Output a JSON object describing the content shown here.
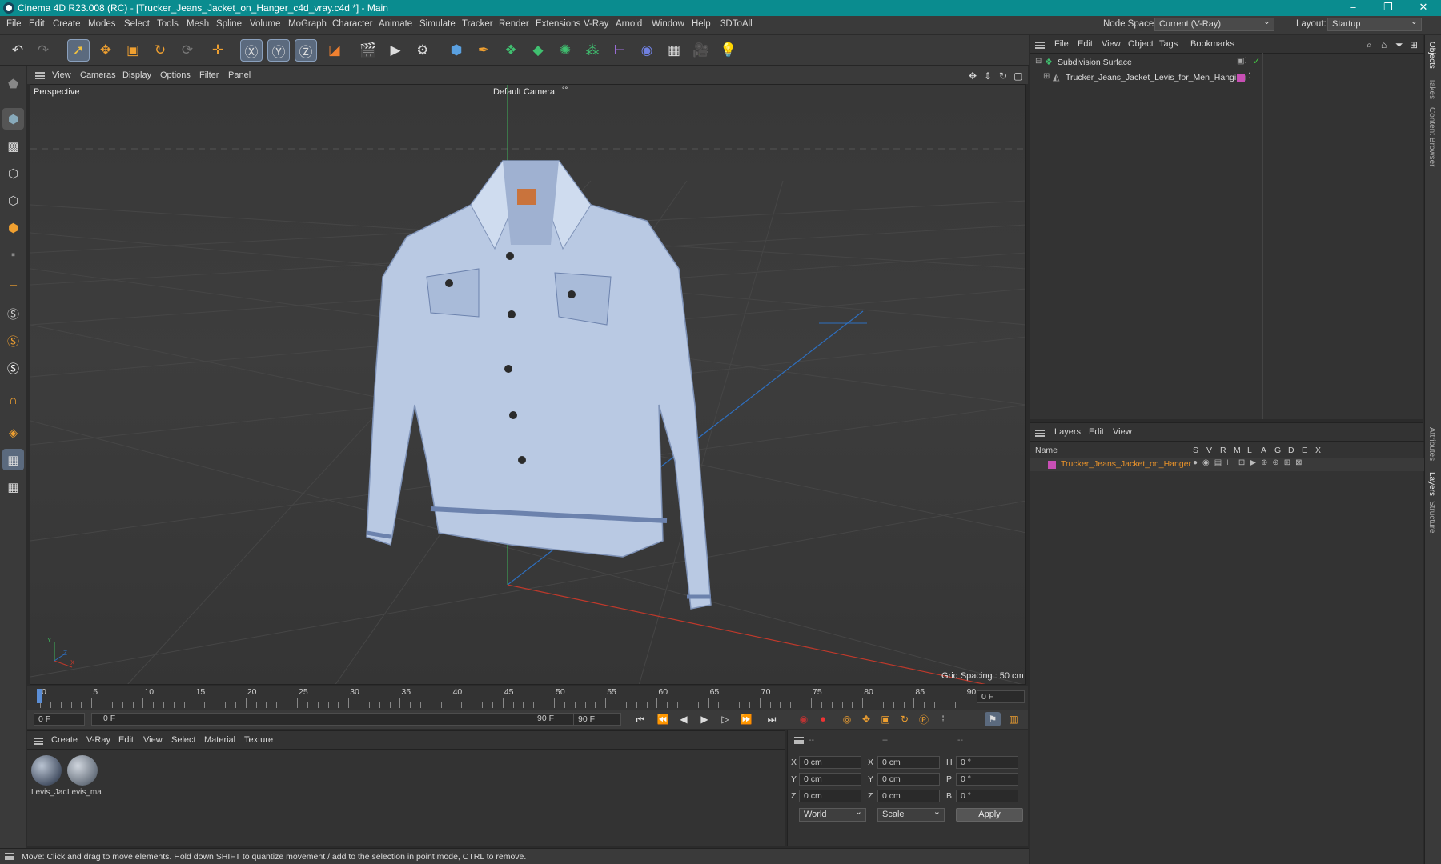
{
  "titlebar": {
    "title": "Cinema 4D R23.008 (RC) - [Trucker_Jeans_Jacket_on_Hanger_c4d_vray.c4d *] - Main",
    "minimize": "–",
    "restore": "❐",
    "close": "✕"
  },
  "menu": [
    "File",
    "Edit",
    "Create",
    "Modes",
    "Select",
    "Tools",
    "Mesh",
    "Spline",
    "Volume",
    "MoGraph",
    "Character",
    "Animate",
    "Simulate",
    "Tracker",
    "Render",
    "Extensions",
    "V-Ray",
    "Arnold",
    "Window",
    "Help",
    "3DToAll"
  ],
  "node_space": {
    "label": "Node Space:",
    "value": "Current (V-Ray)"
  },
  "layout": {
    "label": "Layout:",
    "value": "Startup"
  },
  "viewport_menu": [
    "View",
    "Cameras",
    "Display",
    "Options",
    "Filter",
    "Panel"
  ],
  "viewport": {
    "name": "Perspective",
    "camera": "Default Camera",
    "camera_mark": "°°",
    "grid_spacing": "Grid Spacing : 50 cm",
    "axis_labels": {
      "x": "X",
      "y": "Y",
      "z": "Z"
    }
  },
  "timeline": {
    "ticks": [
      "0",
      "5",
      "10",
      "15",
      "20",
      "25",
      "30",
      "35",
      "40",
      "45",
      "50",
      "55",
      "60",
      "65",
      "70",
      "75",
      "80",
      "85",
      "90"
    ],
    "current_frame": "0 F"
  },
  "transport": {
    "start": "0 F",
    "range_start": "0 F",
    "range_end": "90 F",
    "end": "90 F"
  },
  "material_menu": [
    "Create",
    "V-Ray",
    "Edit",
    "View",
    "Select",
    "Material",
    "Texture"
  ],
  "materials": [
    {
      "name": "Levis_Jac"
    },
    {
      "name": "Levis_ma"
    }
  ],
  "coords": {
    "headers": [
      "--",
      "--",
      "--"
    ],
    "rows": [
      {
        "a": "X",
        "av": "0 cm",
        "b": "X",
        "bv": "0 cm",
        "c": "H",
        "cv": "0 °"
      },
      {
        "a": "Y",
        "av": "0 cm",
        "b": "Y",
        "bv": "0 cm",
        "c": "P",
        "cv": "0 °"
      },
      {
        "a": "Z",
        "av": "0 cm",
        "b": "Z",
        "bv": "0 cm",
        "c": "B",
        "cv": "0 °"
      }
    ],
    "space": "World",
    "mode": "Scale",
    "apply": "Apply"
  },
  "status": "Move: Click and drag to move elements. Hold down SHIFT to quantize movement / add to the selection in point mode, CTRL to remove.",
  "objects_menu": [
    "File",
    "Edit",
    "View",
    "Object",
    "Tags",
    "Bookmarks"
  ],
  "objects": [
    {
      "name": "Subdivision Surface"
    },
    {
      "name": "Trucker_Jeans_Jacket_Levis_for_Men_Hanging"
    }
  ],
  "layers_menu": [
    "Layers",
    "Edit",
    "View"
  ],
  "layers_header": {
    "name": "Name",
    "cols": [
      "S",
      "V",
      "R",
      "M",
      "L",
      "A",
      "G",
      "D",
      "E",
      "X"
    ]
  },
  "layers": [
    {
      "name": "Trucker_Jeans_Jacket_on_Hanger",
      "color": "#c84fb5"
    }
  ],
  "right_tabs": [
    "Objects",
    "Takes",
    "Content Browser",
    "Attributes",
    "Layers",
    "Structure"
  ],
  "colors": {
    "accent_teal": "#0a8c8f",
    "layer_text": "#e8922a",
    "axis_x": "#c0392b",
    "axis_y": "#27ae60",
    "axis_z": "#2e6fbf"
  }
}
